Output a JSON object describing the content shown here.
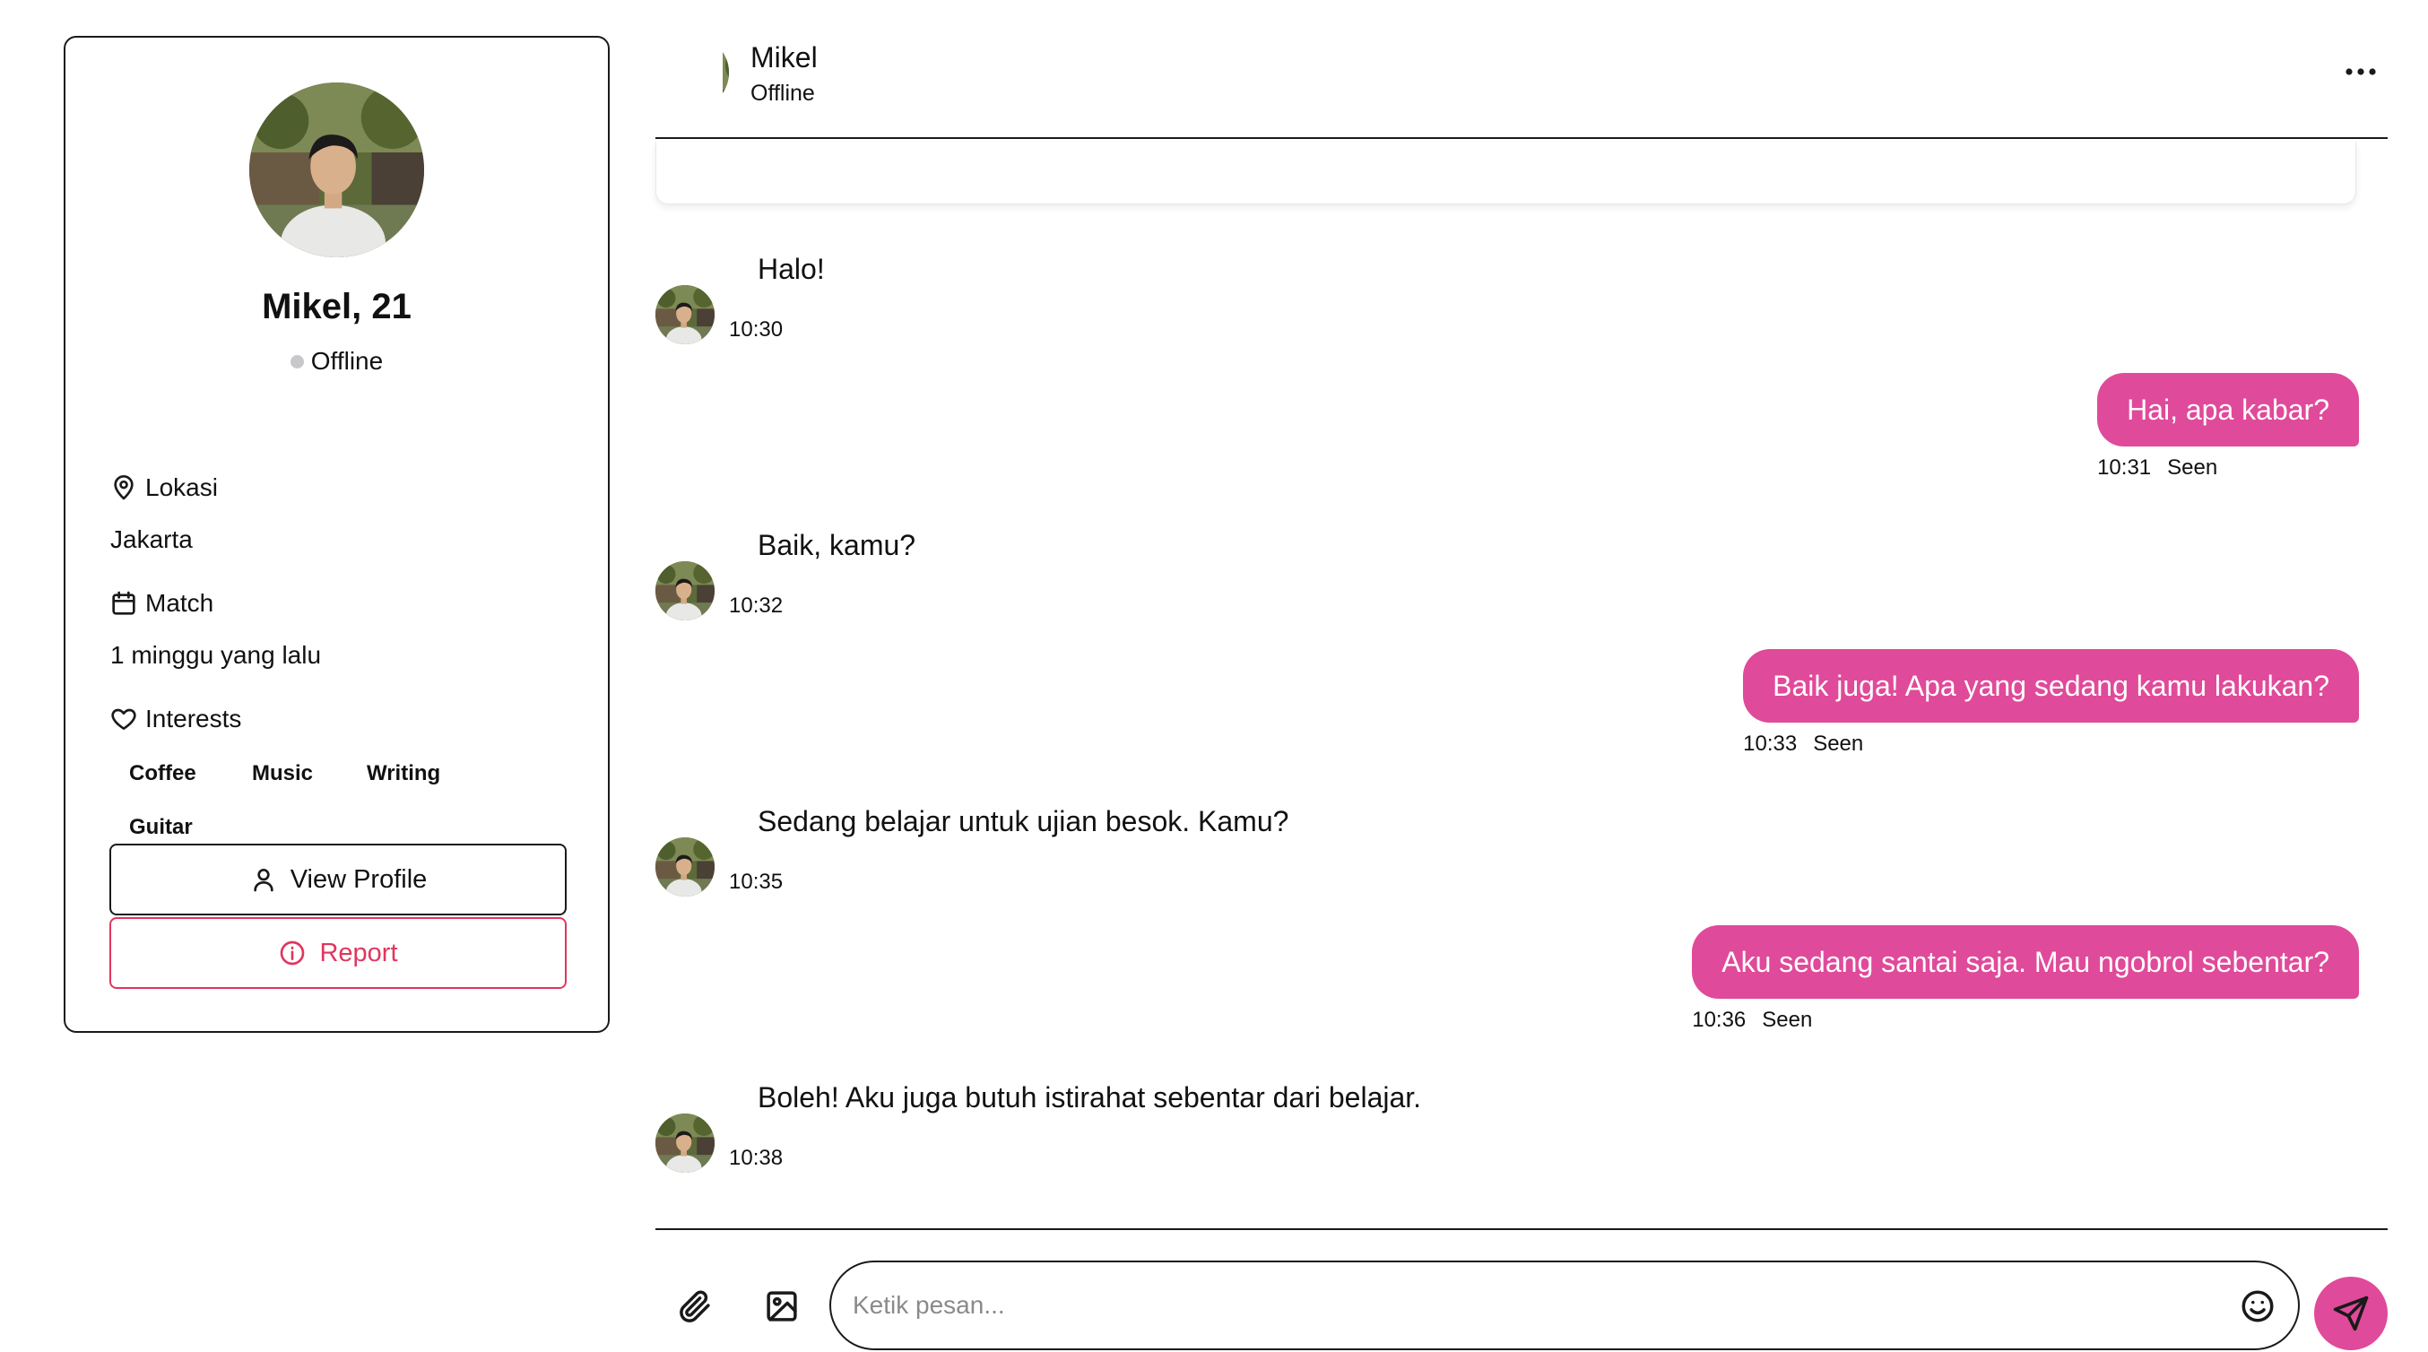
{
  "colors": {
    "accent": "#e04a9a",
    "report": "#e0365f",
    "offline_dot": "#c8c8cc",
    "border": "#1a1a1a"
  },
  "profile": {
    "name_age": "Mikel, 21",
    "status": "Offline",
    "location_label": "Lokasi",
    "location_value": "Jakarta",
    "match_label": "Match",
    "match_value": "1 minggu yang lalu",
    "interests_label": "Interests",
    "interests": [
      "Coffee",
      "Music",
      "Writing",
      "Guitar"
    ],
    "view_profile_label": "View Profile",
    "report_label": "Report",
    "icons": {
      "location": "map-pin-icon",
      "match": "calendar-icon",
      "interests": "heart-icon",
      "view_profile": "user-icon",
      "report": "info-icon"
    }
  },
  "chat_header": {
    "name": "Mikel",
    "status": "Offline",
    "menu_icon": "more-horizontal-icon"
  },
  "messages": [
    {
      "direction": "in",
      "text": "Halo!",
      "time": "10:30"
    },
    {
      "direction": "out",
      "text": "Hai, apa kabar?",
      "time": "10:31",
      "status": "Seen"
    },
    {
      "direction": "in",
      "text": "Baik, kamu?",
      "time": "10:32"
    },
    {
      "direction": "out",
      "text": "Baik juga! Apa yang sedang kamu lakukan?",
      "time": "10:33",
      "status": "Seen"
    },
    {
      "direction": "in",
      "text": "Sedang belajar untuk ujian besok. Kamu?",
      "time": "10:35"
    },
    {
      "direction": "out",
      "text": "Aku sedang santai saja. Mau ngobrol sebentar?",
      "time": "10:36",
      "status": "Seen"
    },
    {
      "direction": "in",
      "text": "Boleh! Aku juga butuh istirahat sebentar dari belajar.",
      "time": "10:38"
    }
  ],
  "composer": {
    "placeholder": "Ketik pesan...",
    "attach_icon": "paperclip-icon",
    "image_icon": "image-icon",
    "emoji_icon": "smile-icon",
    "send_icon": "send-icon"
  }
}
